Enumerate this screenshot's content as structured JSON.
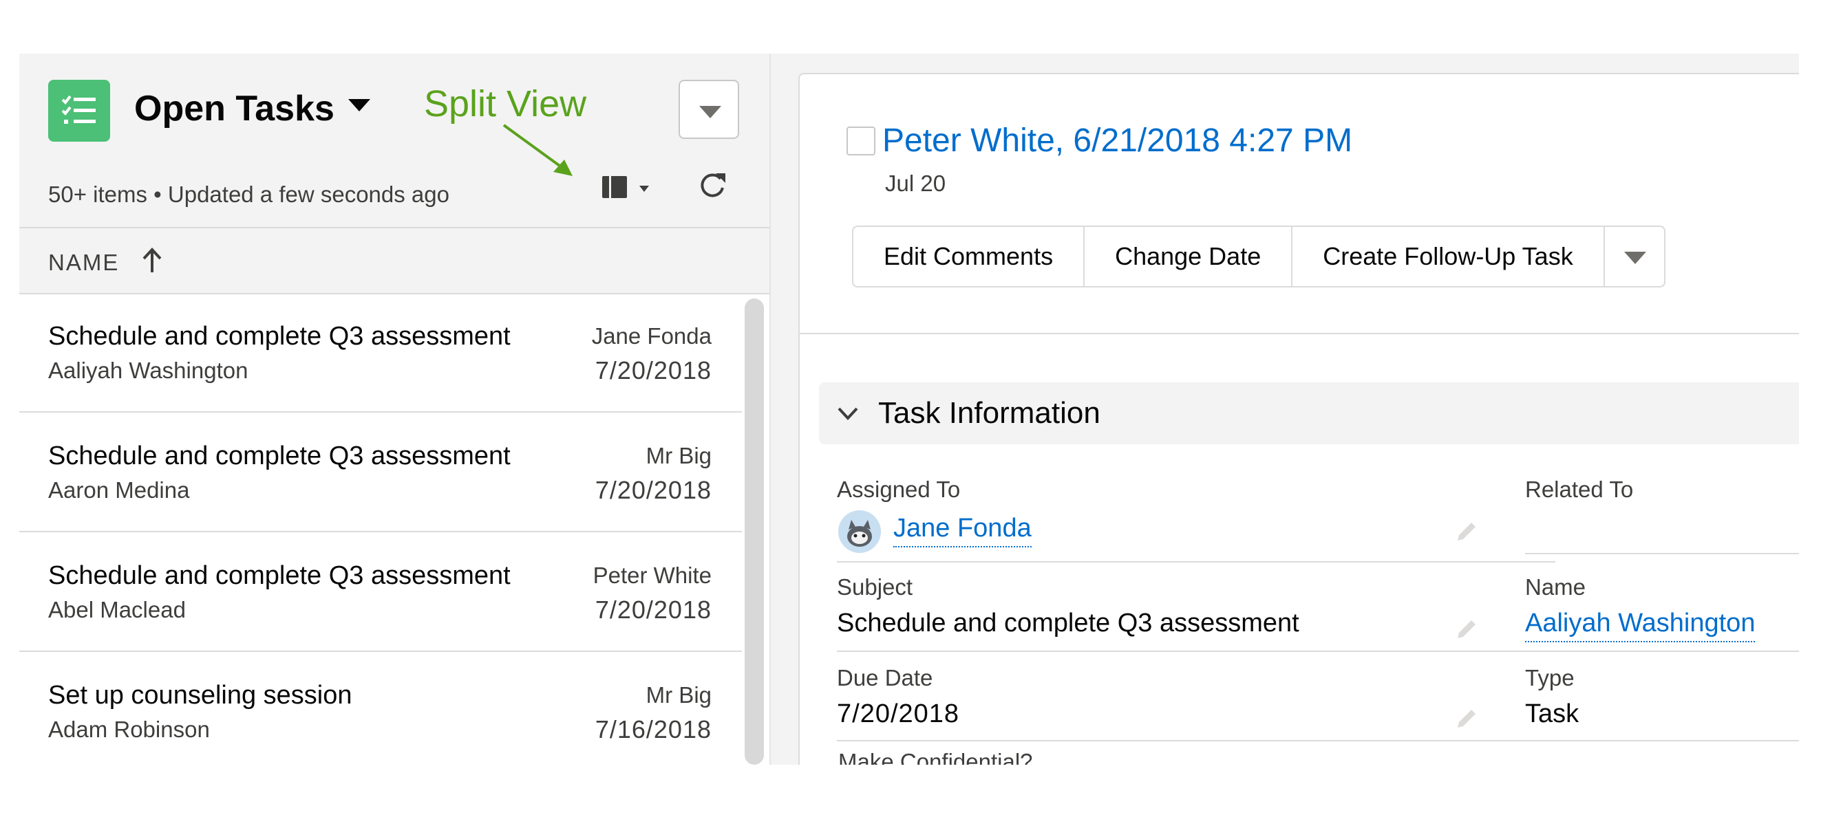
{
  "list": {
    "title": "Open Tasks",
    "meta": "50+ items • Updated a few seconds ago",
    "column_header": "NAME",
    "annotation": "Split View",
    "rows": [
      {
        "subject": "Schedule and complete Q3 assessment",
        "who": "Aaliyah Washington",
        "assignee": "Jane Fonda",
        "date": "7/20/2018"
      },
      {
        "subject": "Schedule and complete Q3 assessment",
        "who": "Aaron Medina",
        "assignee": "Mr Big",
        "date": "7/20/2018"
      },
      {
        "subject": "Schedule and complete Q3 assessment",
        "who": "Abel Maclead",
        "assignee": "Peter White",
        "date": "7/20/2018"
      },
      {
        "subject": "Set up counseling session",
        "who": "Adam Robinson",
        "assignee": "Mr Big",
        "date": "7/16/2018"
      }
    ]
  },
  "detail": {
    "title": "Peter White, 6/21/2018 4:27 PM",
    "subtitle": "Jul 20",
    "buttons": [
      "Edit Comments",
      "Change Date",
      "Create Follow-Up Task"
    ],
    "section_title": "Task Information",
    "fields": {
      "assigned_to": {
        "label": "Assigned To",
        "value": "Jane Fonda"
      },
      "related_to": {
        "label": "Related To",
        "value": ""
      },
      "subject": {
        "label": "Subject",
        "value": "Schedule and complete Q3 assessment"
      },
      "name": {
        "label": "Name",
        "value": "Aaliyah Washington"
      },
      "due_date": {
        "label": "Due Date",
        "value": "7/20/2018"
      },
      "type": {
        "label": "Type",
        "value": "Task"
      },
      "confidential": {
        "label": "Make Confidential?"
      }
    }
  },
  "icons": {
    "app": "task-list-icon",
    "list_dropdown": "chevron-down-icon",
    "view_toggle": "split-view-icon",
    "refresh": "refresh-icon",
    "sort": "arrow-up-icon",
    "section": "chevron-down-icon",
    "edit": "pencil-icon",
    "avatar": "user-avatar-icon"
  },
  "colors": {
    "app_icon": "#4bc076",
    "link": "#006dcc",
    "annotation": "#5aa21c"
  }
}
